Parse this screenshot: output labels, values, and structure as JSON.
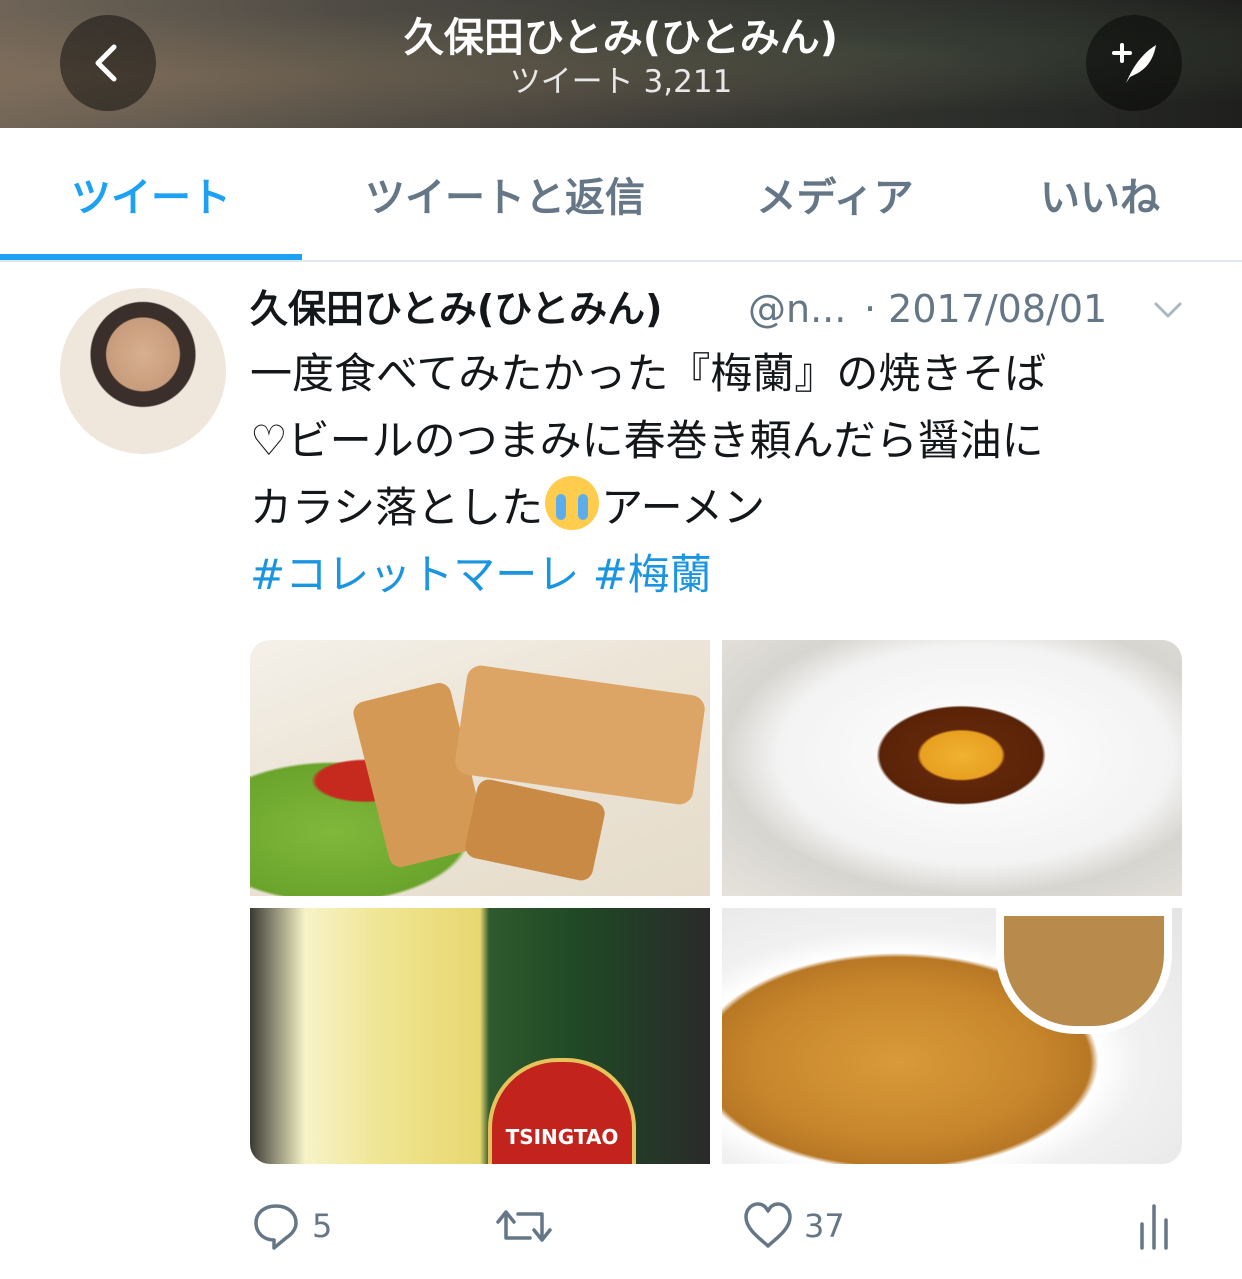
{
  "header": {
    "title": "久保田ひとみ(ひとみん)",
    "subtitle": "ツイート 3,211"
  },
  "tabs": [
    {
      "label": "ツイート",
      "active": true
    },
    {
      "label": "ツイートと返信",
      "active": false
    },
    {
      "label": "メディア",
      "active": false
    },
    {
      "label": "いいね",
      "active": false
    }
  ],
  "tweet": {
    "name": "久保田ひとみ(ひとみん)",
    "handle": "@n...",
    "date": "· 2017/08/01",
    "text_line1": "一度食べてみたかった『梅蘭』の焼きそば",
    "text_line2": "♡ビールのつまみに春巻き頼んだら醤油に",
    "text_line3a": "カラシ落とした",
    "text_line3b": "アーメン",
    "hashtag1": "#コレットマーレ",
    "hashtag2": "#梅蘭",
    "bottle_label": "TSINGTAO",
    "reply_count": "5",
    "like_count": "37"
  },
  "colors": {
    "accent": "#1da1f2",
    "hashtag": "#1b95e0",
    "muted": "#657786"
  },
  "icons": [
    "back-chevron-icon",
    "compose-feather-icon",
    "chevron-down-icon",
    "reply-icon",
    "retweet-icon",
    "heart-icon",
    "analytics-icon",
    "crying-face-emoji"
  ]
}
